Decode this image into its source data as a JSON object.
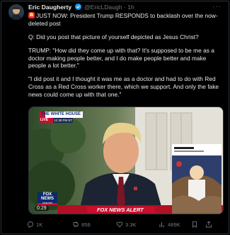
{
  "tweet": {
    "author_name": "Eric Daugherty",
    "handle": "@EricLDaugh",
    "separator": "·",
    "time": "1h",
    "headline": "JUST NOW: President Trump RESPONDS to backlash over the now-deleted post",
    "paragraphs": [
      "Q: Did you post that picture of yourself depicted as Jesus Christ?",
      "TRUMP: \"How did they come up with that? It's supposed to be me as a doctor making people better, and I do make people better and make people a lot better.\"",
      "\"I did post it and I thought it was me as a doctor and had to do with Red Cross as a Red Cross worker there, which we support. And only the fake news could come up with that one.\""
    ]
  },
  "video": {
    "location_bug": "THE WHITE HOUSE",
    "live_label": "LIVE",
    "live_time": "12:38 PM ET",
    "network": "FOX NEWS",
    "channel": "channel",
    "timestamp": "0:29",
    "alert": "FOX NEWS ALERT"
  },
  "actions": {
    "replies": "1K",
    "reposts": "858",
    "likes": "3.3K",
    "views": "489K"
  },
  "colors": {
    "background": "#000000",
    "muted": "#71767b",
    "verified": "#1d9bf0",
    "fox_red": "#c8102e"
  }
}
